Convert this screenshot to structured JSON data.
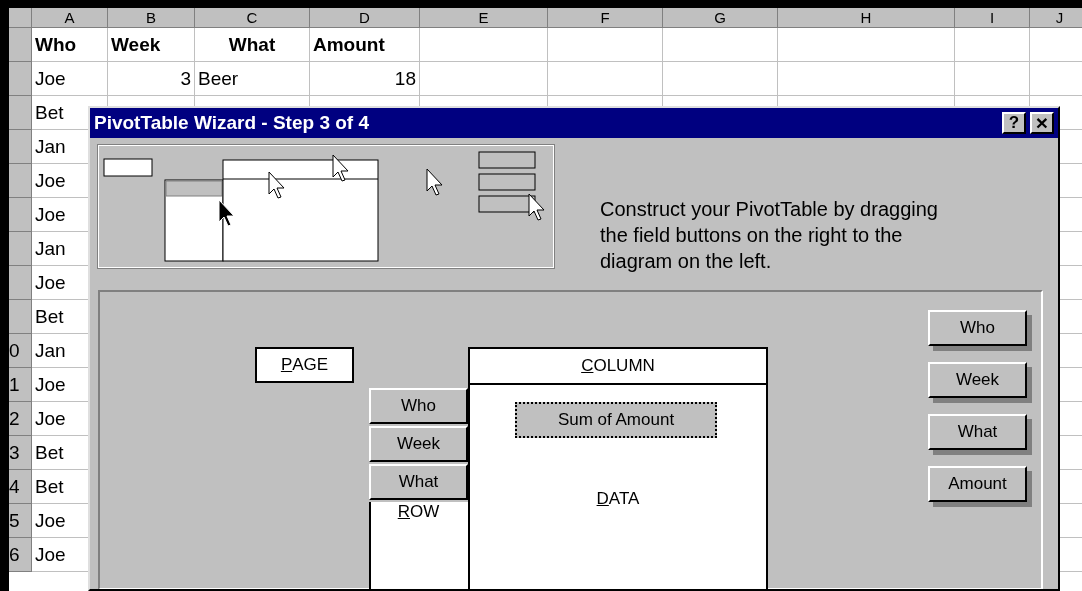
{
  "spreadsheet": {
    "column_headers": [
      "A",
      "B",
      "C",
      "D",
      "E",
      "F",
      "G",
      "H",
      "I",
      "J"
    ],
    "header_row": [
      "Who",
      "Week",
      "What",
      "Amount"
    ],
    "data_row": [
      "Joe",
      "3",
      "Beer",
      "18"
    ],
    "column_a": [
      {
        "value": "Bet"
      },
      {
        "value": "Jan"
      },
      {
        "value": "Joe"
      },
      {
        "value": "Joe"
      },
      {
        "value": "Jan"
      },
      {
        "value": "Joe"
      },
      {
        "value": "Bet"
      },
      {
        "value": "Jan",
        "row_number": "0"
      },
      {
        "value": "Joe",
        "row_number": "1"
      },
      {
        "value": "Joe",
        "row_number": "2"
      },
      {
        "value": "Bet",
        "row_number": "3"
      },
      {
        "value": "Bet",
        "row_number": "4"
      },
      {
        "value": "Joe",
        "row_number": "5"
      },
      {
        "value": "Joe",
        "row_number": "6"
      }
    ]
  },
  "dialog": {
    "title": "PivotTable Wizard - Step 3 of 4",
    "title_buttons": [
      {
        "kind": "help",
        "label": "?"
      },
      {
        "kind": "close",
        "label": "×"
      }
    ],
    "instructions": "Construct your PivotTable by dragging the field buttons on the right to the diagram on the left.",
    "layout": {
      "page_label": "PAGE",
      "column_label": "COLUMN",
      "row_label": "ROW",
      "data_label": "DATA",
      "row_fields": [
        "Who",
        "Week",
        "What"
      ],
      "data_fields": [
        {
          "label": "Sum of Amount",
          "focused": true
        }
      ]
    },
    "field_buttons": [
      "Who",
      "Week",
      "What",
      "Amount"
    ]
  }
}
